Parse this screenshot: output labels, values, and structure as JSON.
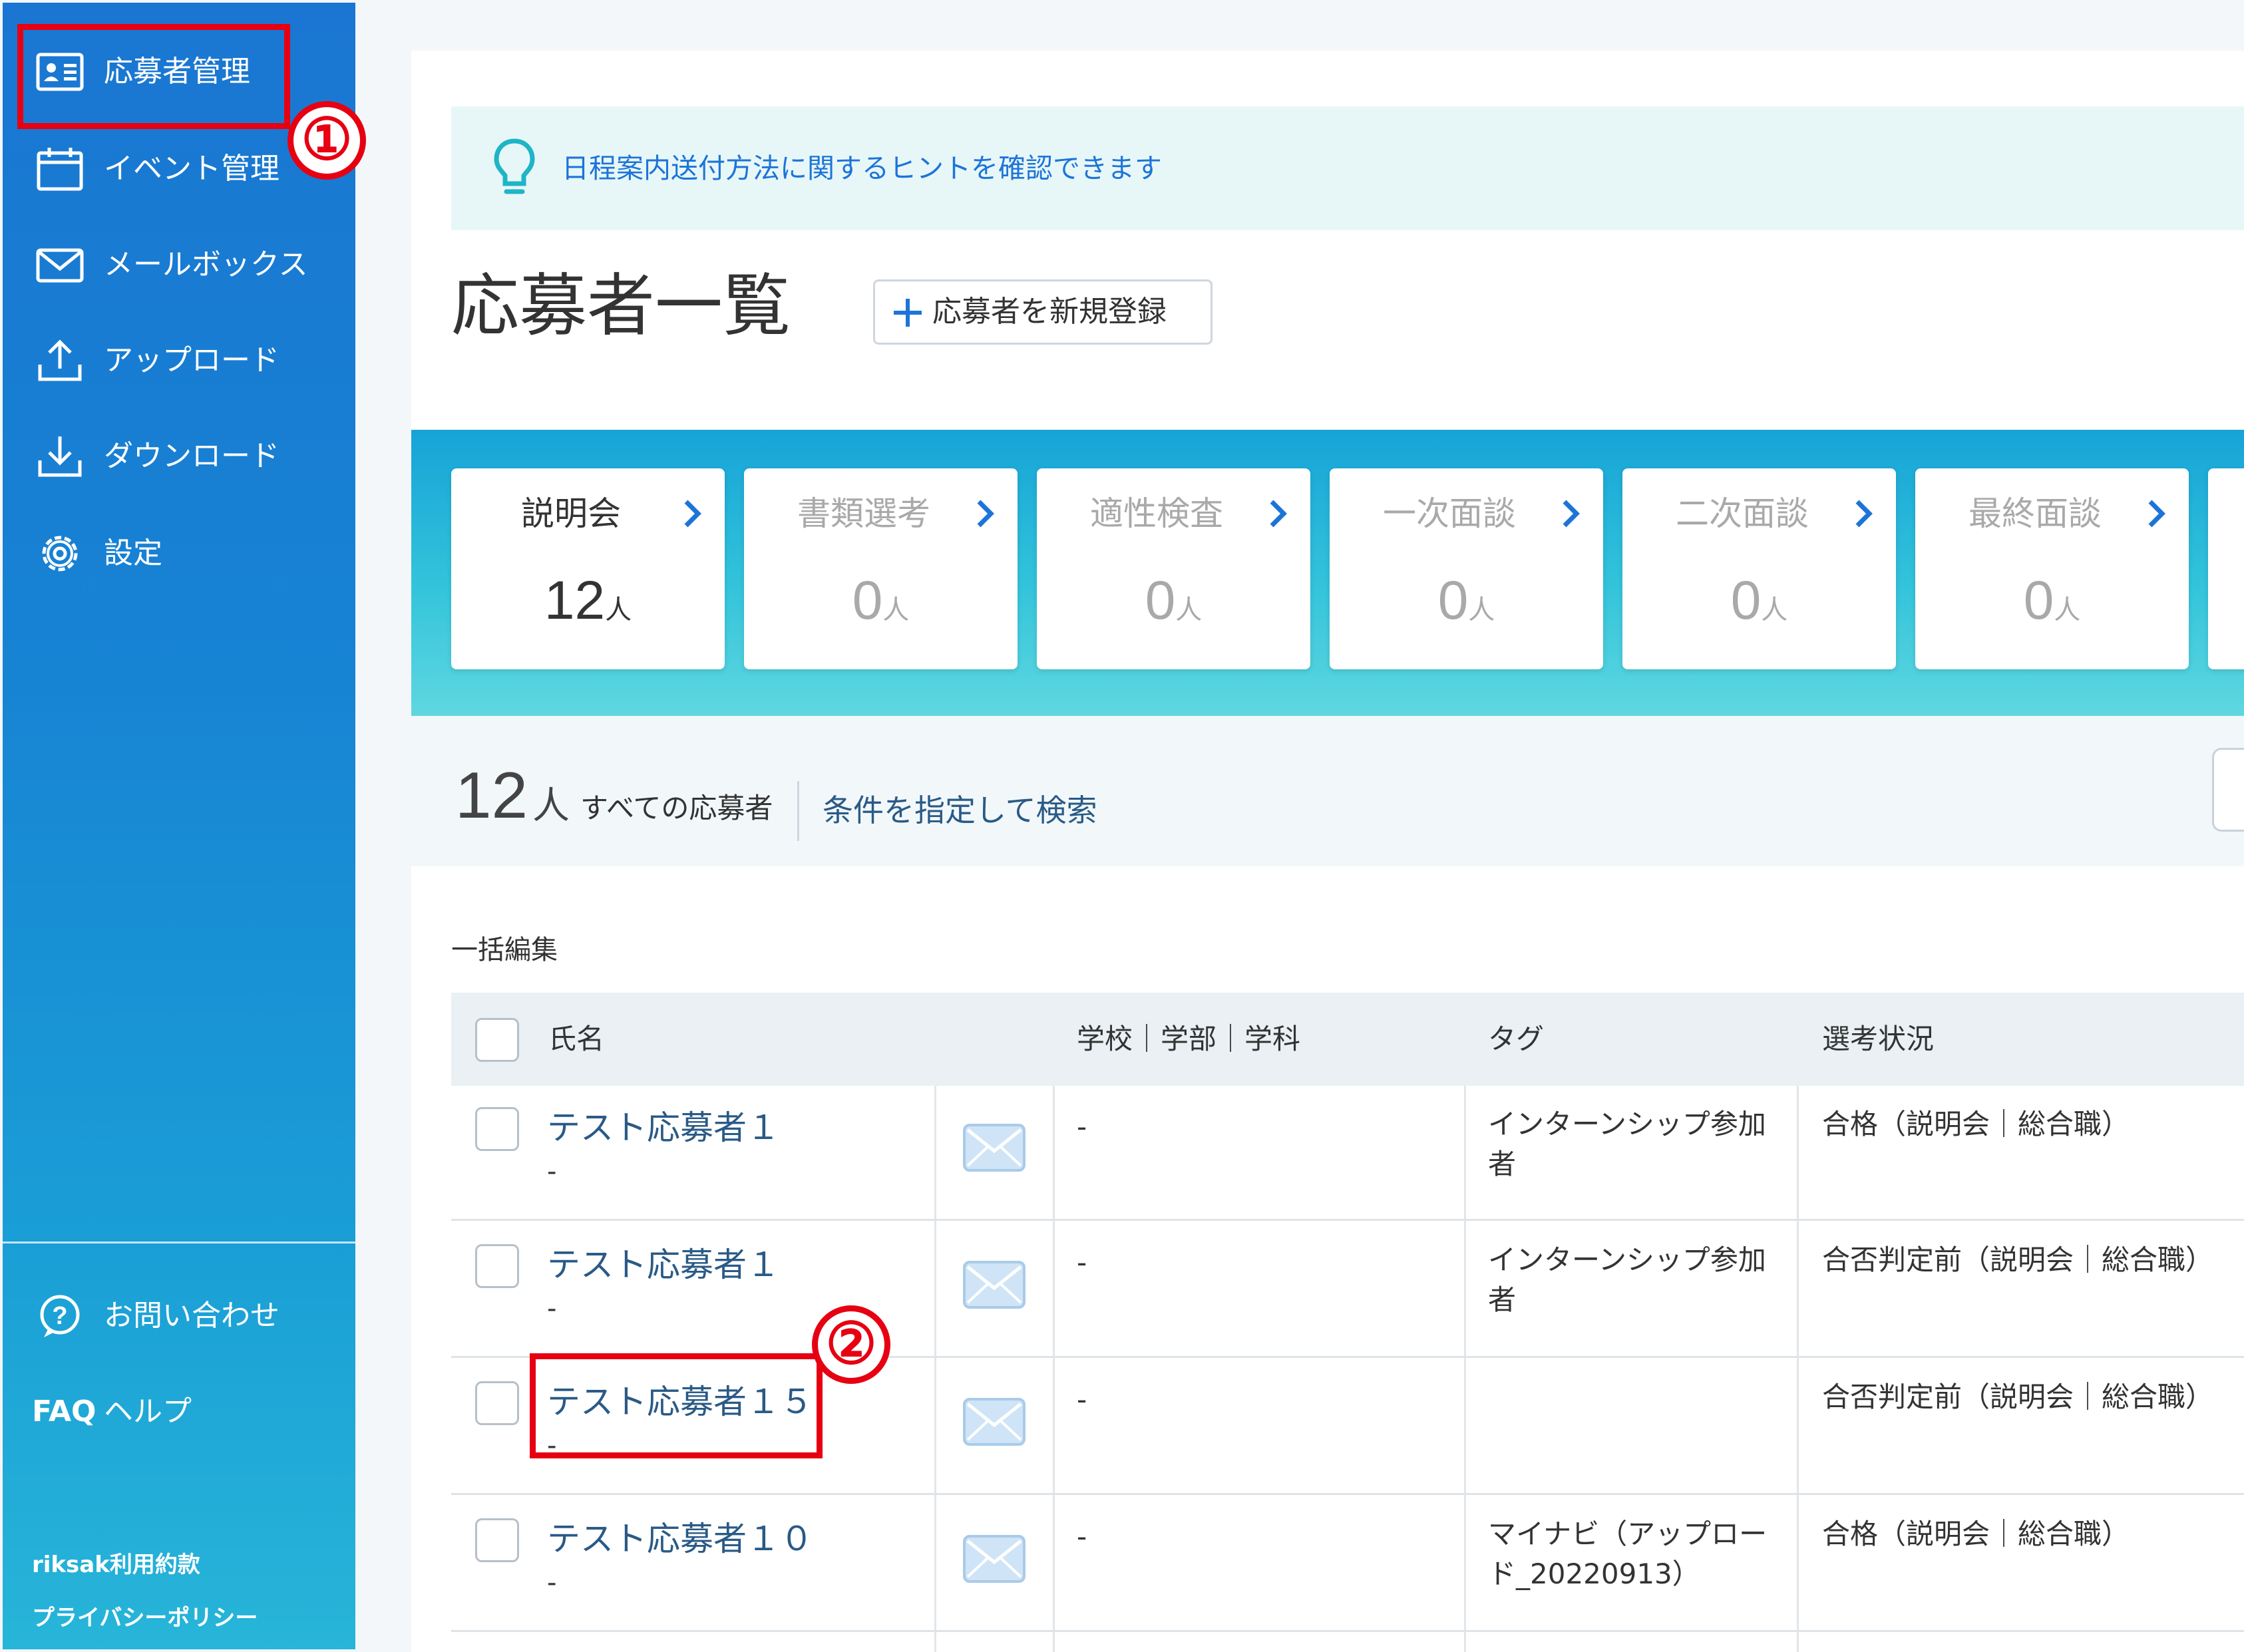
{
  "sidebar": {
    "nav": [
      {
        "label": "応募者管理",
        "icon": "id-card-icon"
      },
      {
        "label": "イベント管理",
        "icon": "calendar-icon"
      },
      {
        "label": "メールボックス",
        "icon": "mail-icon"
      },
      {
        "label": "アップロード",
        "icon": "upload-icon"
      },
      {
        "label": "ダウンロード",
        "icon": "download-icon"
      },
      {
        "label": "設定",
        "icon": "gear-icon"
      }
    ],
    "contact_label": "お問い合わせ",
    "faq_prefix": "FAQ",
    "help_label": "ヘルプ",
    "terms_link": "riksak利用約款",
    "privacy_link": "プライバシーポリシー"
  },
  "annotations": {
    "step1": "①",
    "step2": "②"
  },
  "hint": {
    "text": "日程案内送付方法に関するヒントを確認できます"
  },
  "page": {
    "title": "応募者一覧",
    "new_button": "応募者を新規登録"
  },
  "stages": [
    {
      "name": "説明会",
      "count": "12",
      "unit": "人",
      "active": true
    },
    {
      "name": "書類選考",
      "count": "0",
      "unit": "人",
      "active": false
    },
    {
      "name": "適性検査",
      "count": "0",
      "unit": "人",
      "active": false
    },
    {
      "name": "一次面談",
      "count": "0",
      "unit": "人",
      "active": false
    },
    {
      "name": "二次面談",
      "count": "0",
      "unit": "人",
      "active": false
    },
    {
      "name": "最終面談",
      "count": "0",
      "unit": "人",
      "active": false
    }
  ],
  "summary": {
    "total": "12",
    "unit": "人",
    "all_label": "すべての応募者",
    "search_link": "条件を指定して検索"
  },
  "bulk_edit": "一括編集",
  "table": {
    "headers": {
      "name": "氏名",
      "school": "学校｜学部｜学科",
      "tag": "タグ",
      "status": "選考状況"
    },
    "rows": [
      {
        "name": "テスト応募者１",
        "sub": "-",
        "school": "-",
        "tag_line1": "インターンシップ参加",
        "tag_line2": "者",
        "status": "合格（説明会｜総合職）"
      },
      {
        "name": "テスト応募者１",
        "sub": "-",
        "school": "-",
        "tag_line1": "インターンシップ参加",
        "tag_line2": "者",
        "status": "合否判定前（説明会｜総合職）"
      },
      {
        "name": "テスト応募者１５",
        "sub": "-",
        "school": "-",
        "tag_line1": "",
        "tag_line2": "",
        "status": "合否判定前（説明会｜総合職）"
      },
      {
        "name": "テスト応募者１０",
        "sub": "-",
        "school": "-",
        "tag_line1": "マイナビ（アップロー",
        "tag_line2": "ド_20220913）",
        "status": "合格（説明会｜総合職）"
      }
    ]
  },
  "colors": {
    "sidebar_top": "#1a76d2",
    "sidebar_bottom": "#27b5d8",
    "link": "#2a5a86",
    "hint_text": "#1d74d8",
    "annotation_red": "#e60012",
    "stage_band": "#33c4db"
  }
}
